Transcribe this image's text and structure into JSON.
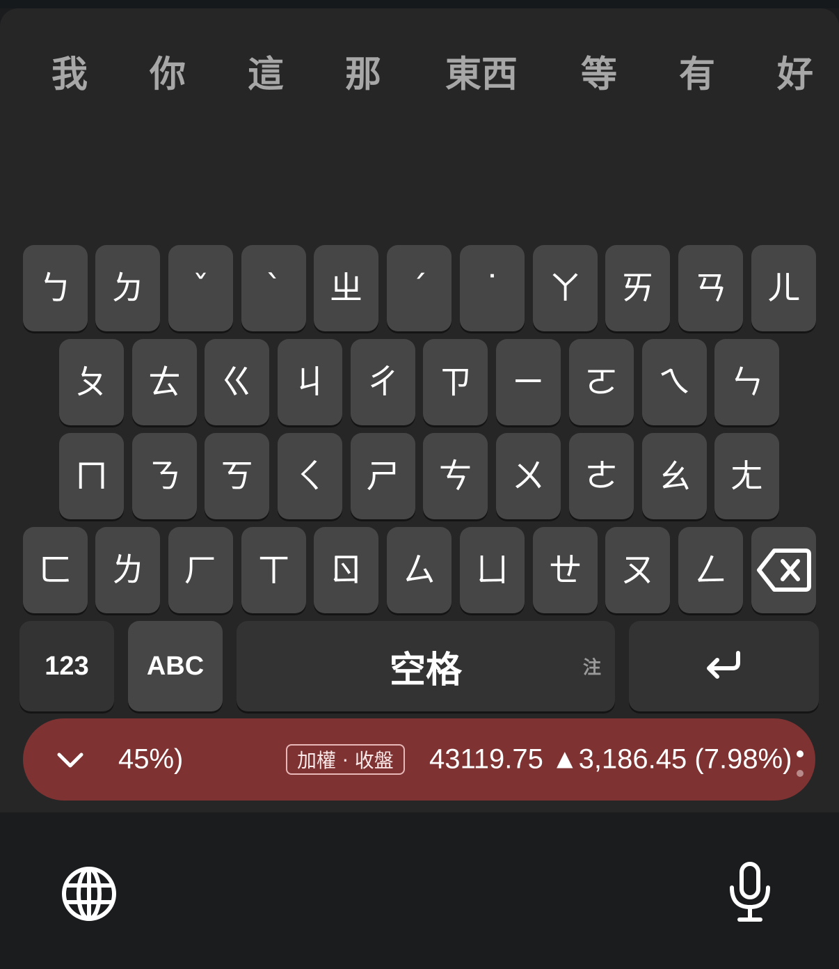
{
  "candidates": [
    "我",
    "你",
    "這",
    "那",
    "東西",
    "等",
    "有",
    "好"
  ],
  "rows": [
    [
      "ㄅ",
      "ㄉ",
      "ˇ",
      "ˋ",
      "ㄓ",
      "ˊ",
      "˙",
      "ㄚ",
      "ㄞ",
      "ㄢ",
      "ㄦ"
    ],
    [
      "ㄆ",
      "ㄊ",
      "ㄍ",
      "ㄐ",
      "ㄔ",
      "ㄗ",
      "ㄧ",
      "ㄛ",
      "ㄟ",
      "ㄣ"
    ],
    [
      "ㄇ",
      "ㄋ",
      "ㄎ",
      "ㄑ",
      "ㄕ",
      "ㄘ",
      "ㄨ",
      "ㄜ",
      "ㄠ",
      "ㄤ"
    ],
    [
      "ㄈ",
      "ㄌ",
      "ㄏ",
      "ㄒ",
      "ㄖ",
      "ㄙ",
      "ㄩ",
      "ㄝ",
      "ㄡ",
      "ㄥ"
    ]
  ],
  "keys": {
    "backspace_icon": "backspace-icon",
    "numbers_label": "123",
    "abc_label": "ABC",
    "space_label": "空格",
    "space_sub_label": "注",
    "return_icon": "return-icon"
  },
  "ticker": {
    "collapse_icon": "chevron-down-icon",
    "percent_fragment": "45%)",
    "badge": "加權 · 收盤",
    "quote": "43119.75 ▲3,186.45 (7.98%)",
    "color": "#7e3232"
  },
  "bottom": {
    "globe_icon": "globe-icon",
    "mic_icon": "microphone-icon"
  },
  "colors": {
    "panel": "#262627",
    "key": "#464646",
    "function_key": "#333334",
    "candidate_text": "#a7a7a7"
  }
}
